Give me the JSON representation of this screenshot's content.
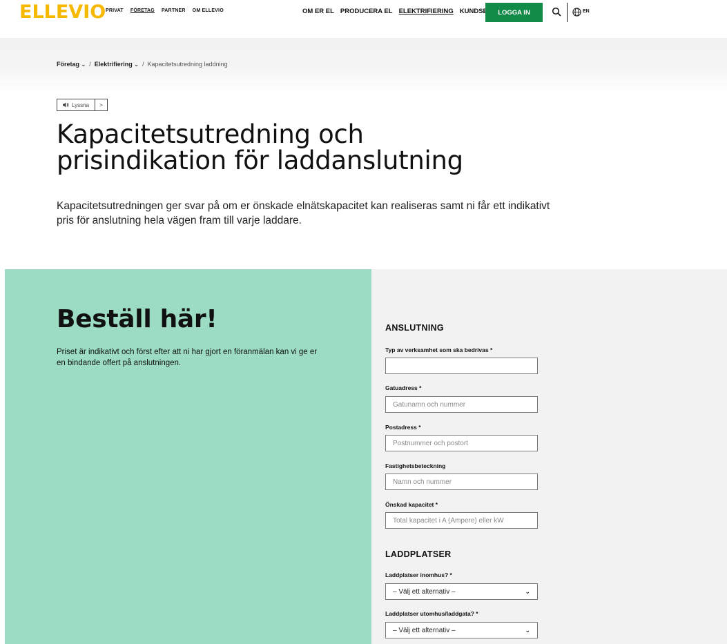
{
  "header": {
    "logo": "ELLEVIO",
    "topnav": [
      {
        "label": "PRIVAT",
        "active": false
      },
      {
        "label": "FÖRETAG",
        "active": true
      },
      {
        "label": "PARTNER",
        "active": false
      },
      {
        "label": "OM ELLEVIO",
        "active": false
      }
    ],
    "mainnav": [
      {
        "label": "OM ER EL",
        "active": false
      },
      {
        "label": "PRODUCERA EL",
        "active": false
      },
      {
        "label": "ELEKTRIFIERING",
        "active": true
      },
      {
        "label": "KUNDSERVICE",
        "active": false
      }
    ],
    "login_label": "LOGGA IN",
    "lang": "EN"
  },
  "breadcrumb": {
    "items": [
      "Företag",
      "Elektrifiering"
    ],
    "current": "Kapacitetsutredning laddning",
    "separator": "/"
  },
  "listen": {
    "label": "Lyssna",
    "next": ">"
  },
  "hero": {
    "title_line1": "Kapacitetsutredning och",
    "title_line2": "prisindikation för laddanslutning",
    "lead": "Kapacitetsutredningen ger svar på om er önskade elnätskapacitet kan realiseras samt ni får ett indikativt pris för anslutning hela vägen fram till varje laddare."
  },
  "order": {
    "title": "Beställ här!",
    "text": "Priset är indikativt och först efter att ni har gjort en föranmälan kan vi ge er en bindande offert på anslutningen."
  },
  "form": {
    "section1": "ANSLUTNING",
    "fields": [
      {
        "label": "Typ av verksamhet som ska bedrivas *",
        "placeholder": "",
        "value": ""
      },
      {
        "label": "Gatuadress *",
        "placeholder": "Gatunamn och nummer",
        "value": ""
      },
      {
        "label": "Postadress *",
        "placeholder": "Postnummer och postort",
        "value": ""
      },
      {
        "label": "Fastighetsbeteckning",
        "placeholder": "Namn och nummer",
        "value": ""
      },
      {
        "label": "Önskad kapacitet *",
        "placeholder": "Total kapacitet i A (Ampere) eller kW",
        "value": ""
      }
    ],
    "section2": "LADDPLATSER",
    "selects": [
      {
        "label": "Laddplatser inomhus? *",
        "selected": "– Välj ett alternativ –"
      },
      {
        "label": "Laddplatser utomhus/laddgata? *",
        "selected": "– Välj ett alternativ –"
      }
    ]
  },
  "colors": {
    "logo": "#f6b900",
    "login_button": "#128a48",
    "order_left_bg": "#9bdcc3",
    "order_right_bg": "#f2f2f2"
  }
}
